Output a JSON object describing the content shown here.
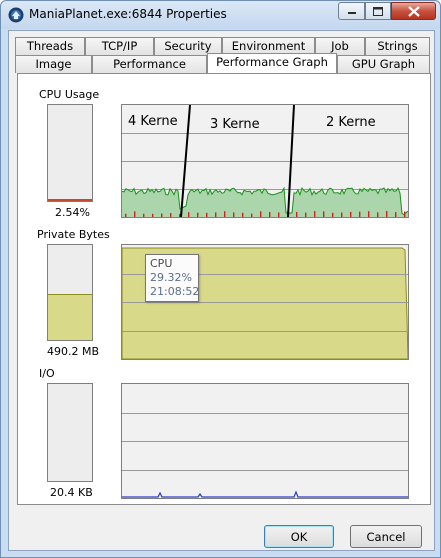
{
  "window": {
    "title": "ManiaPlanet.exe:6844 Properties"
  },
  "tabs_row1": [
    {
      "label": "Threads"
    },
    {
      "label": "TCP/IP"
    },
    {
      "label": "Security"
    },
    {
      "label": "Environment"
    },
    {
      "label": "Job"
    },
    {
      "label": "Strings"
    }
  ],
  "tabs_row2": [
    {
      "label": "Image"
    },
    {
      "label": "Performance"
    },
    {
      "label": "Performance Graph",
      "selected": true
    },
    {
      "label": "GPU Graph"
    }
  ],
  "cpu": {
    "label": "CPU Usage",
    "value_text": "2.54%",
    "level": 0.0254,
    "annotations": [
      "4 Kerne",
      "3 Kerne",
      "2 Kerne"
    ],
    "tooltip": {
      "title": "CPU",
      "value": "29.32%",
      "time": "21:08:52"
    }
  },
  "private_bytes": {
    "label": "Private Bytes",
    "value_text": "490.2 MB",
    "level": 0.48
  },
  "io": {
    "label": "I/O",
    "value_text": "20.4  KB",
    "level": 0
  },
  "buttons": {
    "ok": "OK",
    "cancel": "Cancel"
  },
  "colors": {
    "cpu_fill": "#9fd19f",
    "cpu_line": "#1d8f1d",
    "cpu_kernel": "#d02020",
    "bytes_fill": "#d9d98a",
    "bytes_line": "#8c8c20",
    "io_line": "#2b3fc6"
  }
}
